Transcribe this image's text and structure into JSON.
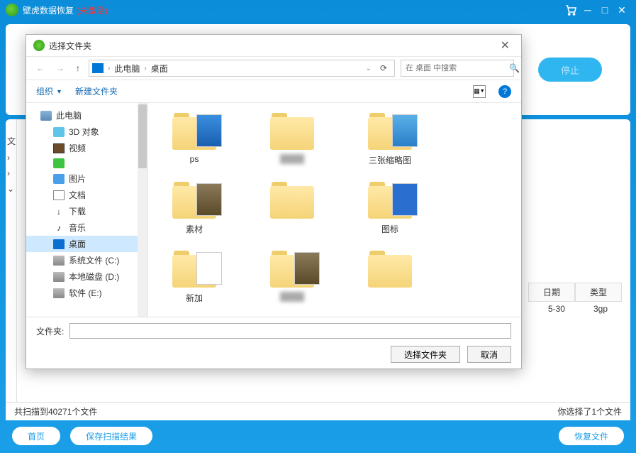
{
  "app": {
    "title": "壁虎数据恢复",
    "status": "(未激活)",
    "stop_btn": "停止"
  },
  "status_bar": {
    "scanned": "共扫描到40271个文件",
    "selected": "你选择了1个文件"
  },
  "bottom": {
    "home": "首页",
    "save_scan": "保存扫描结果",
    "recover": "恢复文件"
  },
  "table": {
    "col_date": "日期",
    "col_type": "类型",
    "date_val": "5-30",
    "type_val": "3gp"
  },
  "left_tree_char": "文",
  "dialog": {
    "title": "选择文件夹",
    "breadcrumb": {
      "root": "此电脑",
      "current": "桌面"
    },
    "search_placeholder": "在 桌面 中搜索",
    "toolbar": {
      "organize": "组织",
      "new_folder": "新建文件夹"
    },
    "tree": [
      {
        "label": "此电脑",
        "icon": "pc",
        "level": 1
      },
      {
        "label": "3D 对象",
        "icon": "3d",
        "level": 2
      },
      {
        "label": "视频",
        "icon": "video",
        "level": 2
      },
      {
        "label": "",
        "icon": "green",
        "level": 2
      },
      {
        "label": "图片",
        "icon": "pic",
        "level": 2
      },
      {
        "label": "文档",
        "icon": "doc",
        "level": 2
      },
      {
        "label": "下载",
        "icon": "dl",
        "level": 2
      },
      {
        "label": "音乐",
        "icon": "music",
        "level": 2
      },
      {
        "label": "桌面",
        "icon": "desktop",
        "level": 2,
        "selected": true
      },
      {
        "label": "系统文件 (C:)",
        "icon": "disk",
        "level": 2
      },
      {
        "label": "本地磁盘 (D:)",
        "icon": "disk",
        "level": 2
      },
      {
        "label": "软件 (E:)",
        "icon": "disk",
        "level": 2
      }
    ],
    "grid": [
      {
        "label": "ps",
        "thumb": "blue"
      },
      {
        "label": "",
        "thumb": "none",
        "blur": true
      },
      {
        "label": "三张缩略图",
        "thumb": "img"
      },
      {
        "label": "素材",
        "thumb": "photo"
      },
      {
        "label": "",
        "thumb": "none"
      },
      {
        "label": "图标",
        "thumb": "blue2"
      },
      {
        "label": "新加",
        "thumb": "white"
      },
      {
        "label": "",
        "thumb": "photo",
        "blur": true
      },
      {
        "label": "",
        "thumb": "none"
      },
      {
        "label": "",
        "thumb": "white"
      },
      {
        "label": "",
        "thumb": "none"
      },
      {
        "label": "",
        "thumb": "blue2"
      }
    ],
    "footer": {
      "folder_label": "文件夹:",
      "select_btn": "选择文件夹",
      "cancel_btn": "取消"
    }
  }
}
